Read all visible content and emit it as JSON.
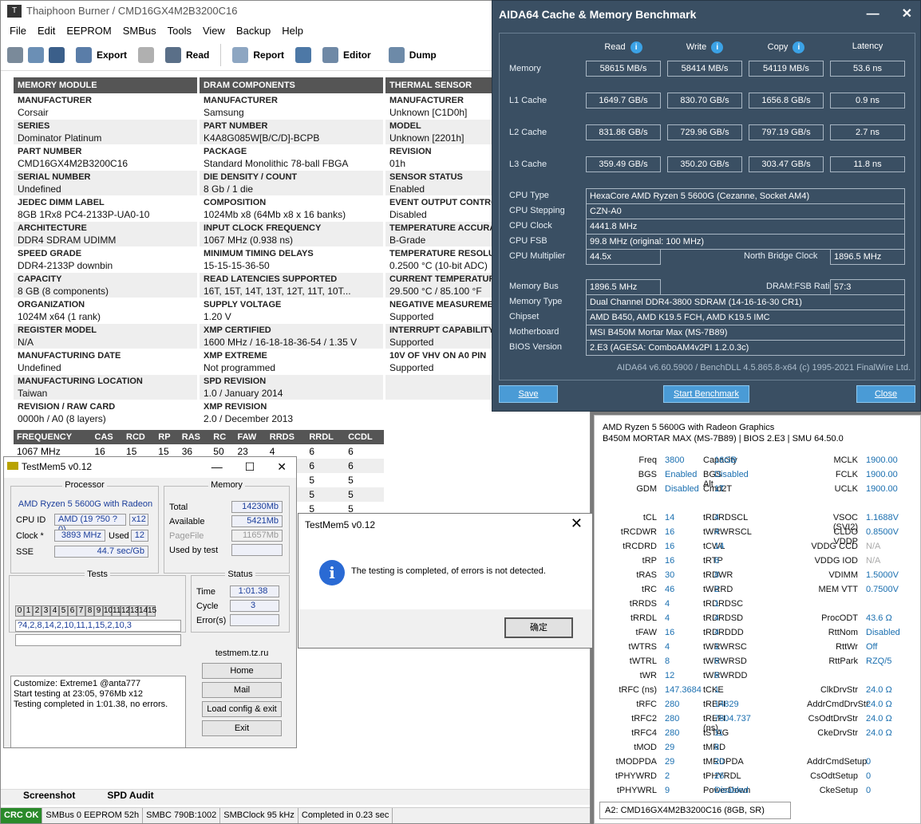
{
  "thaiphoon": {
    "title": "Thaiphoon Burner / CMD16GX4M2B3200C16",
    "menu": [
      "File",
      "Edit",
      "EEPROM",
      "SMBus",
      "Tools",
      "View",
      "Backup",
      "Help"
    ],
    "toolbar": {
      "export": "Export",
      "read": "Read",
      "report": "Report",
      "editor": "Editor",
      "dump": "Dump"
    },
    "columns": [
      {
        "header": "MEMORY MODULE",
        "rows": [
          [
            "MANUFACTURER",
            "Corsair"
          ],
          [
            "SERIES",
            "Dominator Platinum"
          ],
          [
            "PART NUMBER",
            "CMD16GX4M2B3200C16"
          ],
          [
            "SERIAL NUMBER",
            "Undefined"
          ],
          [
            "JEDEC DIMM LABEL",
            "8GB 1Rx8 PC4-2133P-UA0-10"
          ],
          [
            "ARCHITECTURE",
            "DDR4 SDRAM UDIMM"
          ],
          [
            "SPEED GRADE",
            "DDR4-2133P downbin"
          ],
          [
            "CAPACITY",
            "8 GB (8 components)"
          ],
          [
            "ORGANIZATION",
            "1024M x64 (1 rank)"
          ],
          [
            "REGISTER MODEL",
            "N/A"
          ],
          [
            "MANUFACTURING DATE",
            "Undefined"
          ],
          [
            "MANUFACTURING LOCATION",
            "Taiwan"
          ],
          [
            "REVISION / RAW CARD",
            "0000h / A0 (8 layers)"
          ]
        ]
      },
      {
        "header": "DRAM COMPONENTS",
        "rows": [
          [
            "MANUFACTURER",
            "Samsung"
          ],
          [
            "PART NUMBER",
            "K4A8G085W[B/C/D]-BCPB"
          ],
          [
            "PACKAGE",
            "Standard Monolithic 78-ball FBGA"
          ],
          [
            "DIE DENSITY / COUNT",
            "8 Gb / 1 die"
          ],
          [
            "COMPOSITION",
            "1024Mb x8 (64Mb x8 x 16 banks)"
          ],
          [
            "INPUT CLOCK FREQUENCY",
            "1067 MHz (0.938 ns)"
          ],
          [
            "MINIMUM TIMING DELAYS",
            "15-15-15-36-50"
          ],
          [
            "READ LATENCIES SUPPORTED",
            "16T, 15T, 14T, 13T, 12T, 11T, 10T..."
          ],
          [
            "SUPPLY VOLTAGE",
            "1.20 V"
          ],
          [
            "XMP CERTIFIED",
            "1600 MHz / 16-18-18-36-54 / 1.35 V"
          ],
          [
            "XMP EXTREME",
            "Not programmed"
          ],
          [
            "SPD REVISION",
            "1.0 / January 2014"
          ],
          [
            "XMP REVISION",
            "2.0 / December 2013"
          ]
        ]
      },
      {
        "header": "THERMAL SENSOR",
        "rows": [
          [
            "MANUFACTURER",
            "Unknown [C1D0h]"
          ],
          [
            "MODEL",
            "Unknown [2201h]"
          ],
          [
            "REVISION",
            "01h"
          ],
          [
            "SENSOR STATUS",
            "Enabled"
          ],
          [
            "EVENT OUTPUT CONTROL",
            "Disabled"
          ],
          [
            "TEMPERATURE ACCURACY",
            "B-Grade"
          ],
          [
            "TEMPERATURE RESOLUTION",
            "0.2500 °C (10-bit ADC)"
          ],
          [
            "CURRENT TEMPERATURE",
            "29.500 °C / 85.100 °F"
          ],
          [
            "NEGATIVE MEASUREMENT",
            "Supported"
          ],
          [
            "INTERRUPT CAPABILITY",
            "Supported"
          ],
          [
            "10V OF VHV ON A0 PIN",
            "Supported"
          ],
          [
            "",
            ""
          ],
          [
            "",
            ""
          ]
        ]
      }
    ],
    "freq_headers": [
      "FREQUENCY",
      "CAS",
      "RCD",
      "RP",
      "RAS",
      "RC",
      "FAW",
      "RRDS",
      "RRDL",
      "CCDL"
    ],
    "freq_rows": [
      [
        "1067 MHz",
        "16",
        "15",
        "15",
        "36",
        "50",
        "23",
        "4",
        "6",
        "6"
      ],
      [
        "",
        "",
        "",
        "",
        "",
        "",
        "",
        "",
        "6",
        "6"
      ],
      [
        "",
        "",
        "",
        "",
        "",
        "",
        "",
        "",
        "5",
        "5"
      ],
      [
        "",
        "",
        "",
        "",
        "",
        "",
        "",
        "",
        "5",
        "5"
      ],
      [
        "",
        "",
        "",
        "",
        "",
        "",
        "",
        "",
        "5",
        "5"
      ]
    ],
    "tabs": [
      "Screenshot",
      "SPD Audit"
    ],
    "status": [
      "CRC OK",
      "SMBus 0 EEPROM 52h",
      "SMBC 790B:1002",
      "SMBClock 95 kHz",
      "Completed in 0.23 sec"
    ]
  },
  "aida": {
    "title": "AIDA64 Cache & Memory Benchmark",
    "heads": [
      "Read",
      "Write",
      "Copy",
      "Latency"
    ],
    "rows": [
      {
        "label": "Memory",
        "vals": [
          "58615 MB/s",
          "58414 MB/s",
          "54119 MB/s",
          "53.6 ns"
        ]
      },
      {
        "label": "L1 Cache",
        "vals": [
          "1649.7 GB/s",
          "830.70 GB/s",
          "1656.8 GB/s",
          "0.9 ns"
        ]
      },
      {
        "label": "L2 Cache",
        "vals": [
          "831.86 GB/s",
          "729.96 GB/s",
          "797.19 GB/s",
          "2.7 ns"
        ]
      },
      {
        "label": "L3 Cache",
        "vals": [
          "359.49 GB/s",
          "350.20 GB/s",
          "303.47 GB/s",
          "11.8 ns"
        ]
      }
    ],
    "cpu_type_label": "CPU Type",
    "cpu_type": "HexaCore AMD Ryzen 5 5600G  (Cezanne, Socket AM4)",
    "cpu_stepping_label": "CPU Stepping",
    "cpu_stepping": "CZN-A0",
    "cpu_clock_label": "CPU Clock",
    "cpu_clock": "4441.8 MHz",
    "cpu_fsb_label": "CPU FSB",
    "cpu_fsb": "99.8 MHz  (original: 100 MHz)",
    "cpu_mult_label": "CPU Multiplier",
    "cpu_mult": "44.5x",
    "nb_label": "North Bridge Clock",
    "nb": "1896.5 MHz",
    "mem_bus_label": "Memory Bus",
    "mem_bus": "1896.5 MHz",
    "ratio_label": "DRAM:FSB Ratio",
    "ratio": "57:3",
    "mem_type_label": "Memory Type",
    "mem_type": "Dual Channel DDR4-3800 SDRAM  (14-16-16-30 CR1)",
    "chipset_label": "Chipset",
    "chipset": "AMD B450, AMD K19.5 FCH, AMD K19.5 IMC",
    "mobo_label": "Motherboard",
    "mobo": "MSI B450M Mortar Max (MS-7B89)",
    "bios_label": "BIOS Version",
    "bios": "2.E3  (AGESA: ComboAM4v2PI 1.2.0.3c)",
    "copyright": "AIDA64 v6.60.5900 / BenchDLL 4.5.865.8-x64  (c) 1995-2021 FinalWire Ltd.",
    "save": "Save",
    "start": "Start Benchmark",
    "close": "Close"
  },
  "zt": {
    "line1": "AMD Ryzen 5 5600G with Radeon Graphics",
    "line2": "B450M MORTAR MAX (MS-7B89) | BIOS 2.E3 | SMU 64.50.0",
    "rows": [
      [
        "Freq",
        "3800",
        "Capacity",
        "16GB",
        "MCLK",
        "1900.00"
      ],
      [
        "BGS",
        "Enabled",
        "BGS Alt",
        "Disabled",
        "FCLK",
        "1900.00"
      ],
      [
        "GDM",
        "Disabled",
        "Cmd2T",
        "1T",
        "UCLK",
        "1900.00"
      ],
      [
        "",
        "",
        "",
        "",
        "",
        ""
      ],
      [
        "tCL",
        "14",
        "tRDRDSCL",
        "4",
        "VSOC (SVI2)",
        "1.1688V"
      ],
      [
        "tRCDWR",
        "16",
        "tWRWRSCL",
        "4",
        "CLDO VDDP",
        "0.8500V"
      ],
      [
        "tRCDRD",
        "16",
        "tCWL",
        "14",
        "VDDG CCD",
        "N/A"
      ],
      [
        "tRP",
        "16",
        "tRTP",
        "6",
        "VDDG IOD",
        "N/A"
      ],
      [
        "tRAS",
        "30",
        "tRDWR",
        "8",
        "VDIMM",
        "1.5000V"
      ],
      [
        "tRC",
        "46",
        "tWRRD",
        "2",
        "MEM VTT",
        "0.7500V"
      ],
      [
        "tRRDS",
        "4",
        "tRDRDSC",
        "1",
        "",
        ""
      ],
      [
        "tRRDL",
        "4",
        "tRDRDSD",
        "4",
        "ProcODT",
        "43.6 Ω"
      ],
      [
        "tFAW",
        "16",
        "tRDRDDD",
        "4",
        "RttNom",
        "Disabled"
      ],
      [
        "tWTRS",
        "4",
        "tWRWRSC",
        "1",
        "RttWr",
        "Off"
      ],
      [
        "tWTRL",
        "8",
        "tWRWRSD",
        "6",
        "RttPark",
        "RZQ/5"
      ],
      [
        "tWR",
        "12",
        "tWRWRDD",
        "6",
        "",
        ""
      ],
      [
        "tRFC (ns)",
        "147.3684",
        "tCKE",
        "1",
        "ClkDrvStr",
        "24.0 Ω"
      ],
      [
        "tRFC",
        "280",
        "tREFI",
        "14829",
        "AddrCmdDrvStr",
        "24.0 Ω"
      ],
      [
        "tRFC2",
        "280",
        "tREFI (ns)",
        "7804.737",
        "CsOdtDrvStr",
        "24.0 Ω"
      ],
      [
        "tRFC4",
        "280",
        "tSTAG",
        "11",
        "CkeDrvStr",
        "24.0 Ω"
      ],
      [
        "tMOD",
        "29",
        "tMRD",
        "8",
        "",
        ""
      ],
      [
        "tMODPDA",
        "29",
        "tMRDPDA",
        "20",
        "AddrCmdSetup",
        "0"
      ],
      [
        "tPHYWRD",
        "2",
        "tPHYRDL",
        "26",
        "CsOdtSetup",
        "0"
      ],
      [
        "tPHYWRL",
        "9",
        "PowerDown",
        "Disabled",
        "CkeSetup",
        "0"
      ]
    ],
    "select": "A2: CMD16GX4M2B3200C16 (8GB, SR)"
  },
  "tm": {
    "title": "TestMem5 v0.12",
    "processor": "Processor",
    "cpu": "AMD Ryzen 5 5600G with Radeon",
    "cpuid_label": "CPU ID",
    "cpuid": "AMD  (19 ?50 ?0)",
    "cpuid_x": "x12",
    "clock_label": "Clock *",
    "clock": "3893 MHz",
    "used_label": "Used",
    "used": "12",
    "sse_label": "SSE",
    "sse": "44.7 sec/Gb",
    "memory": "Memory",
    "total_label": "Total",
    "total": "14230Mb",
    "avail_label": "Available",
    "avail": "5421Mb",
    "pagefile_label": "PageFile",
    "pagefile": "11657Mb",
    "usedtest_label": "Used by test",
    "tests": "Tests",
    "nums": [
      "0",
      "1",
      "2",
      "3",
      "4",
      "5",
      "6",
      "7",
      "8",
      "9",
      "10",
      "11",
      "12",
      "13",
      "14",
      "15"
    ],
    "seq": "?4,2,8,14,2,10,11,1,15,2,10,3",
    "status": "Status",
    "time_label": "Time",
    "time": "1:01.38",
    "cycle_label": "Cycle",
    "cycle": "3",
    "err_label": "Error(s)",
    "site": "testmem.tz.ru",
    "log": [
      "Customize: Extreme1 @anta777",
      "Start testing at 23:05, 976Mb x12",
      "Testing completed in 1:01.38, no errors."
    ],
    "home": "Home",
    "mail": "Mail",
    "load": "Load config & exit",
    "exit": "Exit"
  },
  "dialog": {
    "title": "TestMem5 v0.12",
    "message": "The testing is completed, of errors is not detected.",
    "ok": "确定"
  },
  "colors": {
    "aida_bg": "#3a4f63",
    "accent_blue": "#1a6fb0",
    "crc_green": "#2a8a2a"
  }
}
